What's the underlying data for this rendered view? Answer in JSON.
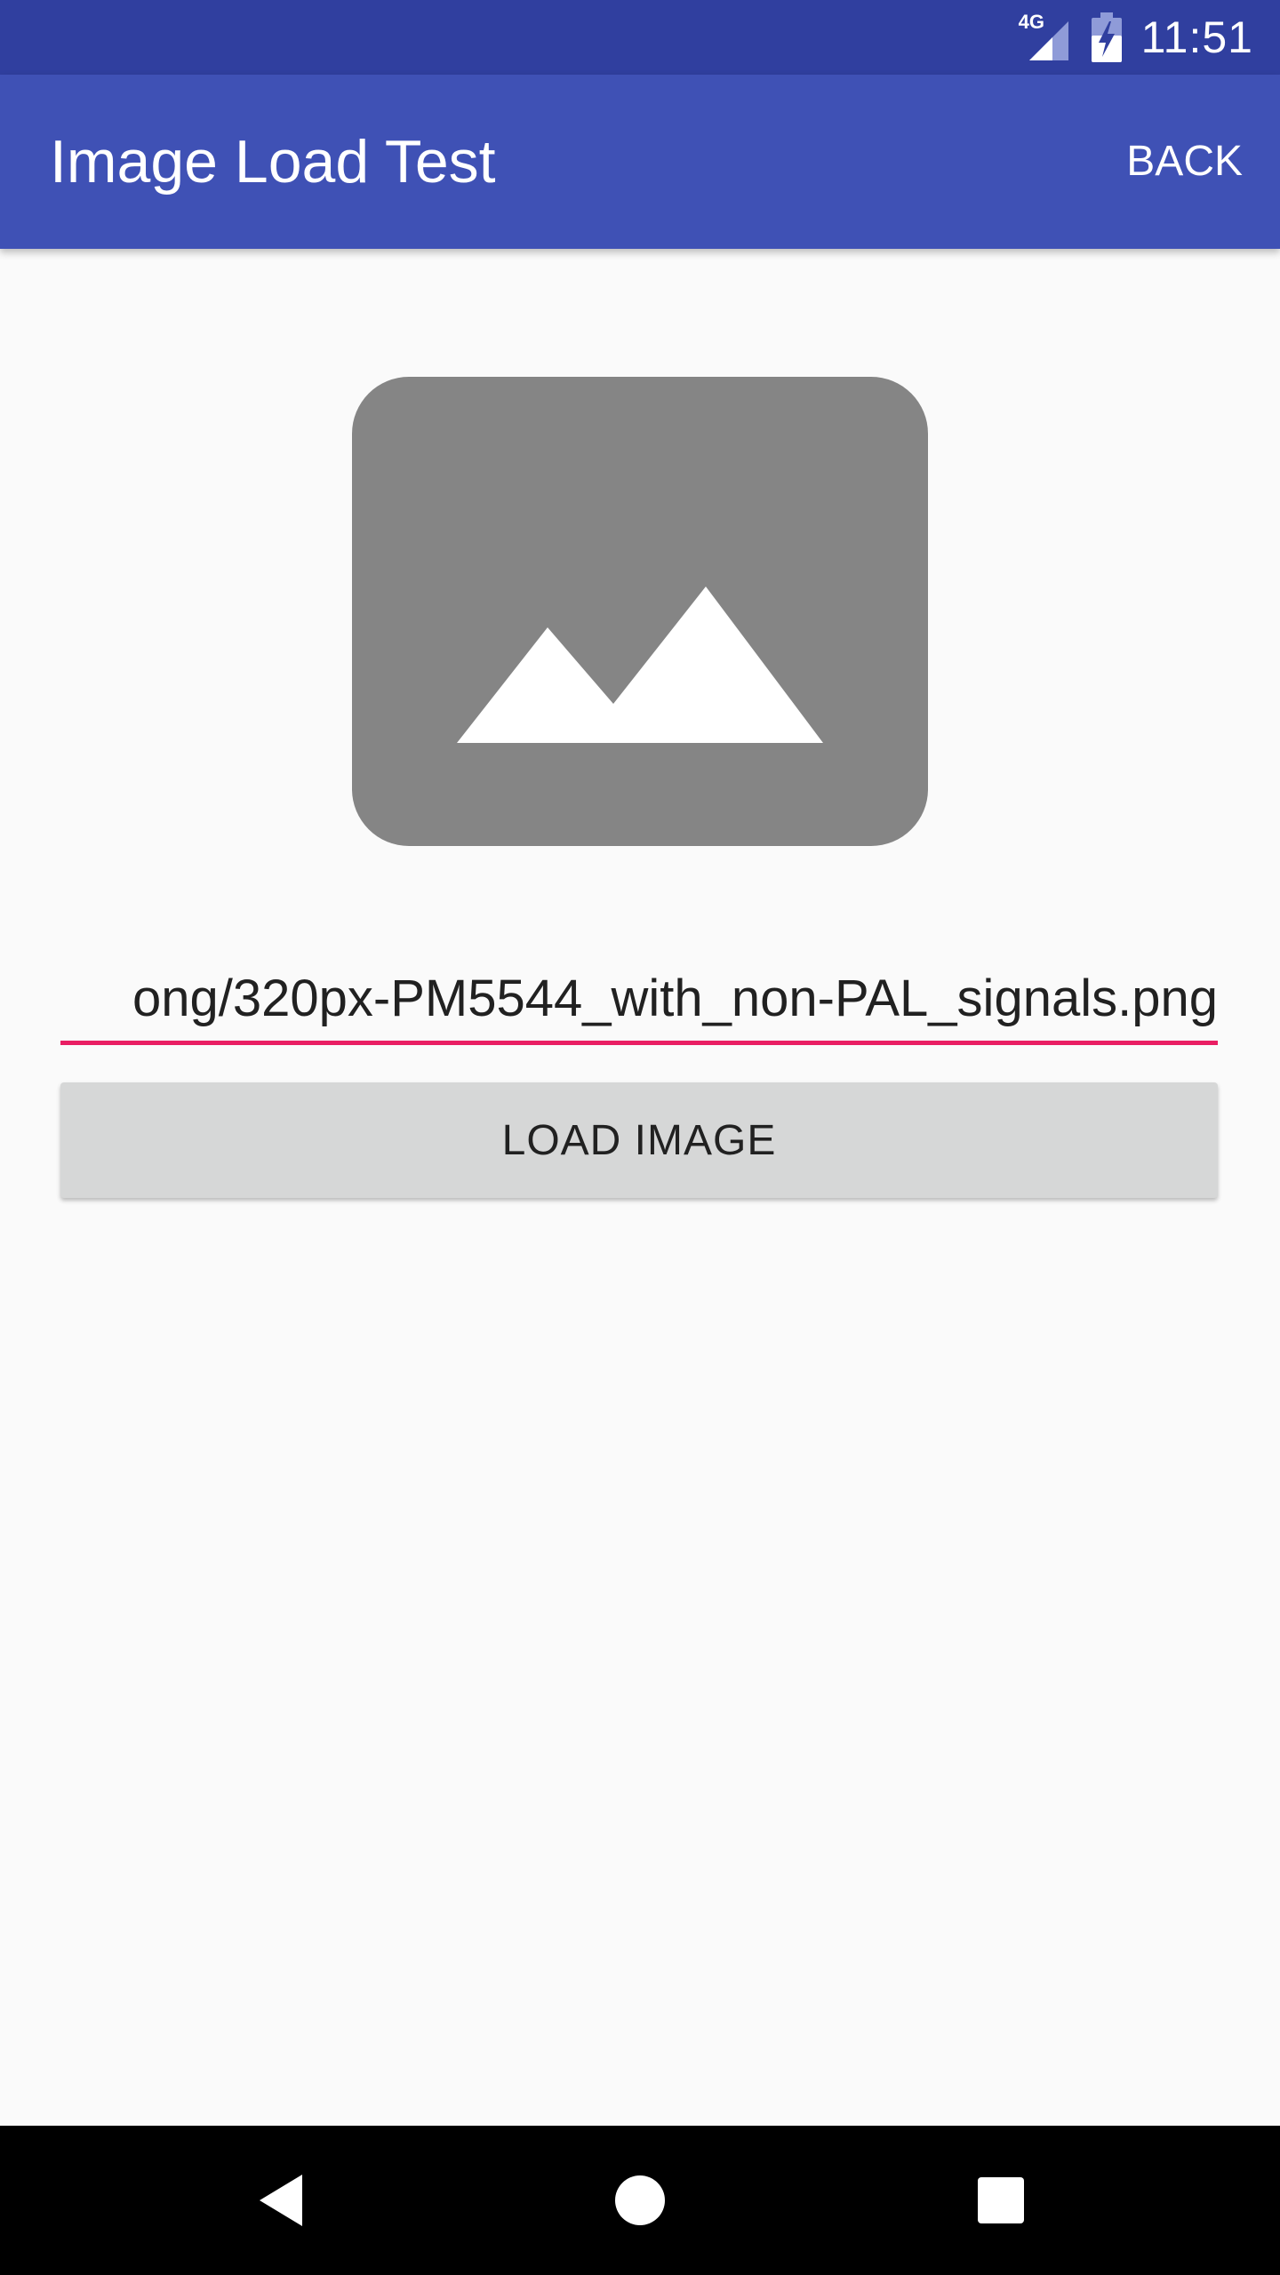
{
  "status_bar": {
    "network_type": "4G",
    "time": "11:51",
    "icons": [
      "signal-icon",
      "battery-charging-icon"
    ]
  },
  "app_bar": {
    "title": "Image Load Test",
    "action_label": "BACK"
  },
  "image_view": {
    "icon": "image-placeholder-icon"
  },
  "url_input": {
    "value": "ong/320px-PM5544_with_non-PAL_signals.png"
  },
  "load_button": {
    "label": "LOAD IMAGE"
  },
  "nav_bar": {
    "icons": [
      "back-icon",
      "home-icon",
      "recents-icon"
    ]
  },
  "colors": {
    "status_bar": "#303f9f",
    "app_bar": "#3f51b5",
    "accent": "#e91e63",
    "background": "#fafafa",
    "button": "#d6d7d7",
    "placeholder": "#858585"
  }
}
